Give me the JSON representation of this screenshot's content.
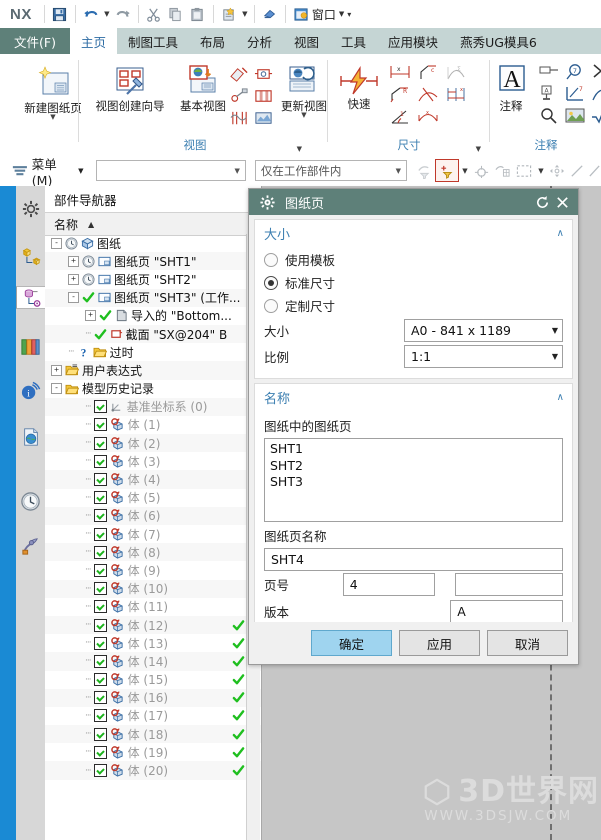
{
  "quick_access": {
    "logo": "NX",
    "buttons": [
      {
        "name": "save-icon",
        "label": "保存"
      },
      {
        "name": "undo-icon",
        "label": "撤销"
      },
      {
        "name": "redo-icon",
        "label": "重做"
      },
      {
        "name": "cut-icon",
        "label": "剪切"
      },
      {
        "name": "copy-icon",
        "label": "复制"
      },
      {
        "name": "paste-icon",
        "label": "粘贴"
      },
      {
        "name": "paste-special-icon",
        "label": "选择性粘贴"
      },
      {
        "name": "eraser-icon",
        "label": "撤销删除"
      }
    ],
    "window_menu": "窗口"
  },
  "ribbon_tabs": [
    {
      "label": "文件(F)",
      "kind": "file"
    },
    {
      "label": "主页",
      "kind": "active"
    },
    {
      "label": "制图工具",
      "kind": "normal"
    },
    {
      "label": "布局",
      "kind": "normal"
    },
    {
      "label": "分析",
      "kind": "normal"
    },
    {
      "label": "视图",
      "kind": "normal"
    },
    {
      "label": "工具",
      "kind": "normal"
    },
    {
      "label": "应用模块",
      "kind": "normal"
    },
    {
      "label": "燕秀UG模具6",
      "kind": "normal"
    }
  ],
  "ribbon": {
    "groups": [
      {
        "title": "",
        "big": [
          {
            "label": "新建图纸页",
            "icon": "new-sheet-icon"
          }
        ]
      },
      {
        "title": "视图",
        "big": [
          {
            "label": "视图创建向导",
            "icon": "view-wizard-icon"
          },
          {
            "label": "基本视图",
            "icon": "base-view-icon"
          },
          {
            "label": "更新视图",
            "icon": "update-view-icon"
          }
        ]
      },
      {
        "title": "尺寸",
        "big": [
          {
            "label": "快速",
            "icon": "quick-dimension-icon"
          }
        ]
      },
      {
        "title": "注释",
        "big": [
          {
            "label": "注释",
            "icon": "annotation-icon"
          }
        ]
      }
    ]
  },
  "selection_bar": {
    "menu_label": "菜单(M)",
    "type_filter_value": "",
    "scope_value": "仅在工作部件内"
  },
  "rail_icons": [
    {
      "name": "settings-rail-icon",
      "selected": false
    },
    {
      "name": "assembly-navigator-rail-icon",
      "selected": false
    },
    {
      "name": "part-navigator-rail-icon",
      "selected": true
    },
    {
      "name": "reuse-library-rail-icon",
      "selected": false
    },
    {
      "name": "hd3d-rail-icon",
      "selected": false
    },
    {
      "name": "web-browser-rail-icon",
      "selected": false
    },
    {
      "name": "history-rail-icon",
      "selected": false
    },
    {
      "name": "roles-rail-icon",
      "selected": false
    }
  ],
  "navigator": {
    "title": "部件导航器",
    "column_header": "名称",
    "sort_indicator": "▲",
    "tree": [
      {
        "indent": 0,
        "expander": "-",
        "icons": [
          "clock-icon",
          "drawing-icon"
        ],
        "label": "图纸",
        "grey": false,
        "check": null,
        "status": null
      },
      {
        "indent": 1,
        "expander": "+",
        "icons": [
          "clock-icon",
          "sheet-icon"
        ],
        "label": "图纸页 \"SHT1\"",
        "grey": false,
        "check": null,
        "status": null
      },
      {
        "indent": 1,
        "expander": "+",
        "icons": [
          "clock-icon",
          "sheet-icon"
        ],
        "label": "图纸页 \"SHT2\"",
        "grey": false,
        "check": null,
        "status": null
      },
      {
        "indent": 1,
        "expander": "-",
        "icons": [
          "green-check-icon",
          "sheet-icon"
        ],
        "label": "图纸页 \"SHT3\" (工作...",
        "grey": false,
        "check": null,
        "status": null
      },
      {
        "indent": 2,
        "expander": "+",
        "icons": [
          "green-check-icon",
          "imported-icon"
        ],
        "label": "导入的 \"Bottom...",
        "grey": false,
        "check": null,
        "status": null
      },
      {
        "indent": 2,
        "expander": "",
        "icons": [
          "green-check-icon",
          "section-icon"
        ],
        "label": "截面 \"SX@204\" B",
        "grey": false,
        "check": null,
        "status": null
      },
      {
        "indent": 1,
        "expander": "",
        "icons": [
          "question-icon",
          "folder-icon"
        ],
        "label": "过时",
        "grey": false,
        "check": null,
        "status": null
      },
      {
        "indent": 0,
        "expander": "+",
        "icons": [
          "folder-expr-icon"
        ],
        "label": "用户表达式",
        "grey": false,
        "check": null,
        "status": null
      },
      {
        "indent": 0,
        "expander": "-",
        "icons": [
          "folder-icon"
        ],
        "label": "模型历史记录",
        "grey": false,
        "check": null,
        "status": null
      },
      {
        "indent": 2,
        "expander": "",
        "icons": [
          "datum-csys-icon"
        ],
        "label": "基准坐标系 (0)",
        "grey": true,
        "check": true,
        "status": null
      },
      {
        "indent": 2,
        "expander": "",
        "icons": [
          "body-icon"
        ],
        "label": "体 (1)",
        "grey": true,
        "check": true,
        "status": null
      },
      {
        "indent": 2,
        "expander": "",
        "icons": [
          "body-icon"
        ],
        "label": "体 (2)",
        "grey": true,
        "check": true,
        "status": null
      },
      {
        "indent": 2,
        "expander": "",
        "icons": [
          "body-icon"
        ],
        "label": "体 (3)",
        "grey": true,
        "check": true,
        "status": null
      },
      {
        "indent": 2,
        "expander": "",
        "icons": [
          "body-icon"
        ],
        "label": "体 (4)",
        "grey": true,
        "check": true,
        "status": null
      },
      {
        "indent": 2,
        "expander": "",
        "icons": [
          "body-icon"
        ],
        "label": "体 (5)",
        "grey": true,
        "check": true,
        "status": null
      },
      {
        "indent": 2,
        "expander": "",
        "icons": [
          "body-icon"
        ],
        "label": "体 (6)",
        "grey": true,
        "check": true,
        "status": null
      },
      {
        "indent": 2,
        "expander": "",
        "icons": [
          "body-icon"
        ],
        "label": "体 (7)",
        "grey": true,
        "check": true,
        "status": null
      },
      {
        "indent": 2,
        "expander": "",
        "icons": [
          "body-icon"
        ],
        "label": "体 (8)",
        "grey": true,
        "check": true,
        "status": null
      },
      {
        "indent": 2,
        "expander": "",
        "icons": [
          "body-icon"
        ],
        "label": "体 (9)",
        "grey": true,
        "check": true,
        "status": null
      },
      {
        "indent": 2,
        "expander": "",
        "icons": [
          "body-icon"
        ],
        "label": "体 (10)",
        "grey": true,
        "check": true,
        "status": null
      },
      {
        "indent": 2,
        "expander": "",
        "icons": [
          "body-icon"
        ],
        "label": "体 (11)",
        "grey": true,
        "check": true,
        "status": null
      },
      {
        "indent": 2,
        "expander": "",
        "icons": [
          "body-icon"
        ],
        "label": "体 (12)",
        "grey": true,
        "check": true,
        "status": "check"
      },
      {
        "indent": 2,
        "expander": "",
        "icons": [
          "body-icon"
        ],
        "label": "体 (13)",
        "grey": true,
        "check": true,
        "status": "check"
      },
      {
        "indent": 2,
        "expander": "",
        "icons": [
          "body-icon"
        ],
        "label": "体 (14)",
        "grey": true,
        "check": true,
        "status": "check"
      },
      {
        "indent": 2,
        "expander": "",
        "icons": [
          "body-icon"
        ],
        "label": "体 (15)",
        "grey": true,
        "check": true,
        "status": "check"
      },
      {
        "indent": 2,
        "expander": "",
        "icons": [
          "body-icon"
        ],
        "label": "体 (16)",
        "grey": true,
        "check": true,
        "status": "check"
      },
      {
        "indent": 2,
        "expander": "",
        "icons": [
          "body-icon"
        ],
        "label": "体 (17)",
        "grey": true,
        "check": true,
        "status": "check"
      },
      {
        "indent": 2,
        "expander": "",
        "icons": [
          "body-icon"
        ],
        "label": "体 (18)",
        "grey": true,
        "check": true,
        "status": "check"
      },
      {
        "indent": 2,
        "expander": "",
        "icons": [
          "body-icon"
        ],
        "label": "体 (19)",
        "grey": true,
        "check": true,
        "status": "check"
      },
      {
        "indent": 2,
        "expander": "",
        "icons": [
          "body-icon"
        ],
        "label": "体 (20)",
        "grey": true,
        "check": true,
        "status": "check"
      }
    ]
  },
  "dialog": {
    "title": "图纸页",
    "reset_icon": "reset-icon",
    "close_icon": "close-icon",
    "sections": {
      "size": {
        "title": "大小",
        "collapse_icon": "∧",
        "radios": [
          {
            "label": "使用模板",
            "selected": false
          },
          {
            "label": "标准尺寸",
            "selected": true
          },
          {
            "label": "定制尺寸",
            "selected": false
          }
        ],
        "size_label": "大小",
        "size_value": "A0 - 841 x 1189",
        "scale_label": "比例",
        "scale_value": "1:1"
      },
      "name": {
        "title": "名称",
        "collapse_icon": "∧",
        "list_label": "图纸中的图纸页",
        "list_items": [
          "SHT1",
          "SHT2",
          "SHT3"
        ],
        "sheet_name_label": "图纸页名称",
        "sheet_name_value": "SHT4",
        "page_no_label": "页号",
        "page_no_value": "4",
        "page_no_extra_value": "",
        "revision_label": "版本",
        "revision_value": "A"
      }
    },
    "footer": {
      "ok": "确定",
      "apply": "应用",
      "cancel": "取消"
    }
  },
  "watermark": {
    "logo_text": "3D世界网",
    "url": "WWW.3DSJW.COM"
  },
  "colors": {
    "ribbon_accent": "#3c7fb1",
    "dialog_header": "#5e8079",
    "tab_bar": "#c5d5d4",
    "rail_blue": "#1a8ad4",
    "primary_button": "#9fd4ef"
  }
}
